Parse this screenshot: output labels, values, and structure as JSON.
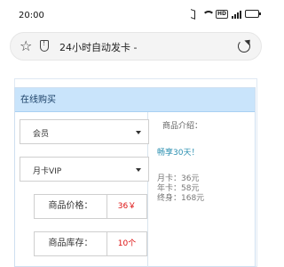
{
  "status_bar": {
    "time": "20:00",
    "hd_label": "HD",
    "battery_level": 0.85
  },
  "browser": {
    "page_title": "24小时自动发卡 -"
  },
  "purchase": {
    "header": "在线购买",
    "category_select": "会员",
    "product_select": "月卡VIP",
    "price_label": "商品价格：",
    "price_value": "36￥",
    "stock_label": "商品库存：",
    "stock_value": "10个"
  },
  "product_info": {
    "title": "商品介绍：",
    "promo": "畅享30天！",
    "prices": [
      "月卡：36元",
      "年卡：58元",
      "终身：168元"
    ]
  }
}
